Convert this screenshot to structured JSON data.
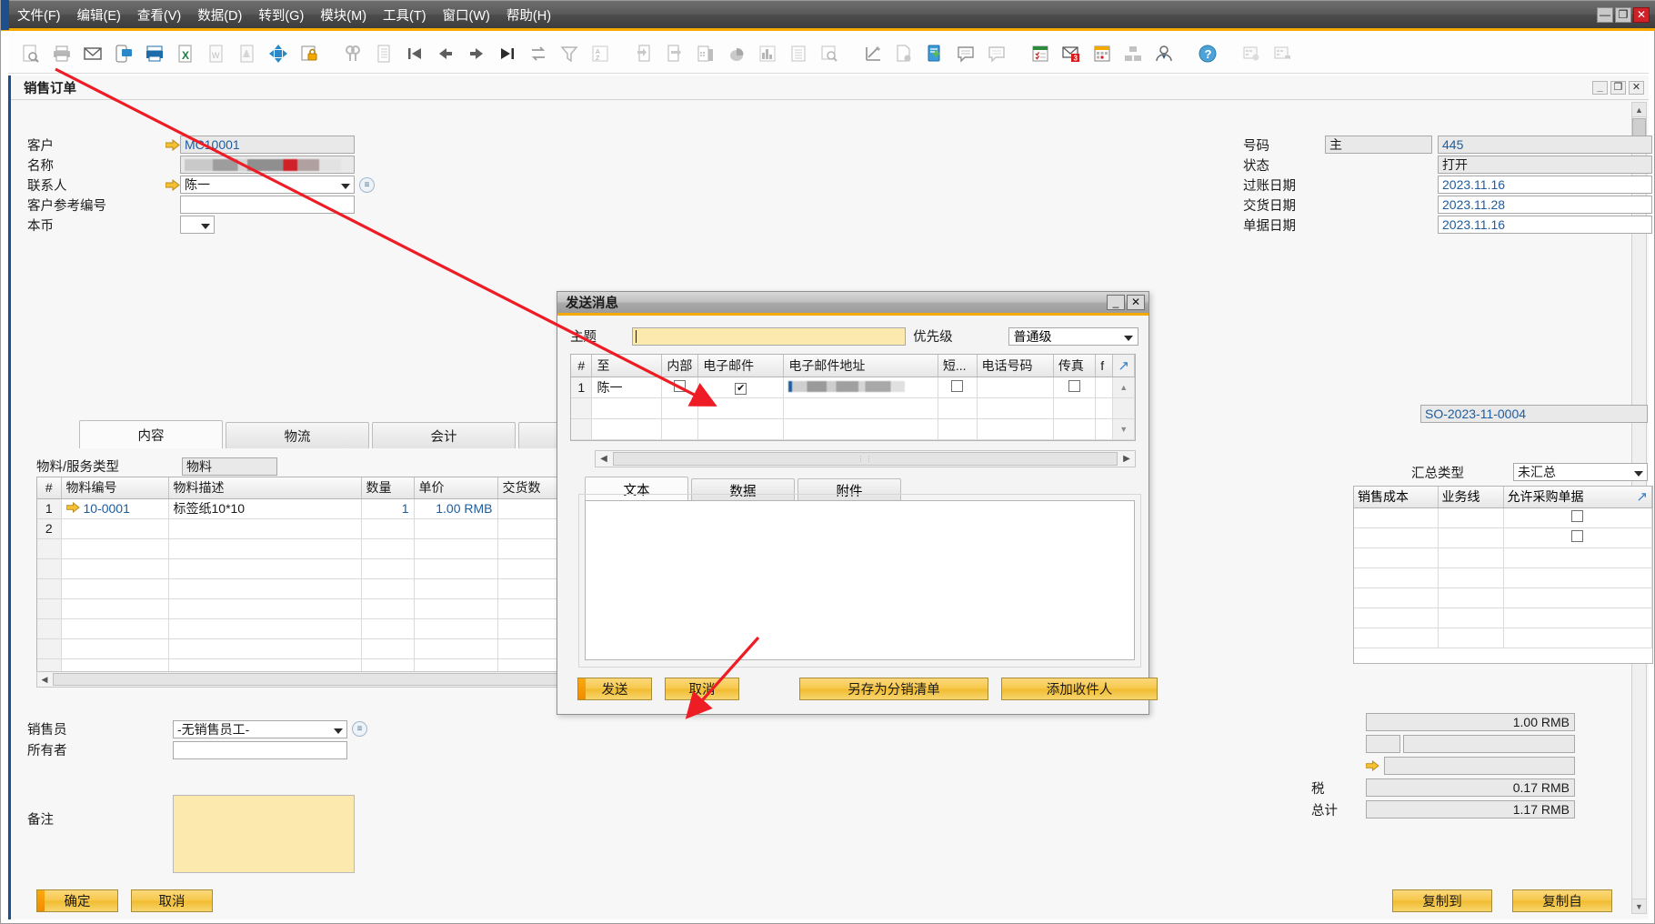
{
  "menubar": {
    "items": [
      {
        "label": "文件(F)",
        "accel": "F"
      },
      {
        "label": "编辑(E)",
        "accel": "E"
      },
      {
        "label": "查看(V)",
        "accel": "V"
      },
      {
        "label": "数据(D)",
        "accel": "D"
      },
      {
        "label": "转到(G)",
        "accel": "G"
      },
      {
        "label": "模块(M)",
        "accel": "M"
      },
      {
        "label": "工具(T)",
        "accel": "T"
      },
      {
        "label": "窗口(W)",
        "accel": "W"
      },
      {
        "label": "帮助(H)",
        "accel": "H"
      }
    ],
    "window_controls": {
      "minimize": "—",
      "restore": "❐",
      "close": "✕"
    }
  },
  "toolbar": {
    "icons": [
      "print-preview-icon",
      "print-icon",
      "email-icon",
      "sms-icon",
      "fax-icon",
      "export-excel-icon",
      "export-word-icon",
      "export-pdf-icon",
      "launch-app-icon",
      "lock-icon",
      "find-icon",
      "list-icon",
      "first-record-icon",
      "previous-record-icon",
      "next-record-icon",
      "last-record-icon",
      "add-row-icon",
      "filter-icon",
      "sort-icon",
      "copy-from-icon",
      "copy-to-icon",
      "calculator-icon",
      "pie-chart-icon",
      "bar-chart-icon",
      "report-icon",
      "query-icon",
      "graph-edit-icon",
      "document-settings-icon",
      "database-addon-icon",
      "message-icon",
      "message-send-icon",
      "calendar-tasks-icon",
      "inbox-alert-icon",
      "schedule-icon",
      "org-chart-icon",
      "user-icon",
      "help-icon",
      "drag-cells-icon",
      "drag-cells-out-icon"
    ]
  },
  "document": {
    "title": "销售订单",
    "controls": {
      "minimize": "_",
      "restore": "❐",
      "close": "✕"
    },
    "header_left": [
      {
        "label": "客户",
        "value": "MC10001",
        "link": true,
        "type": "text",
        "style": "gray-blue"
      },
      {
        "label": "名称",
        "value": "",
        "link": false,
        "type": "redacted",
        "style": "gray"
      },
      {
        "label": "联系人",
        "value": "陈一",
        "link": true,
        "type": "dropdown",
        "has_note": true
      },
      {
        "label": "客户参考编号",
        "value": "",
        "link": false,
        "type": "text",
        "style": "white"
      },
      {
        "label": "本币",
        "value": "",
        "link": false,
        "type": "dropdown-small"
      }
    ],
    "header_right": [
      {
        "label": "号码",
        "sub": "主",
        "value": "445"
      },
      {
        "label": "状态",
        "sub": "",
        "value": "打开"
      },
      {
        "label": "过账日期",
        "sub": "",
        "value": "2023.11.16"
      },
      {
        "label": "交货日期",
        "sub": "",
        "value": "2023.11.28"
      },
      {
        "label": "单据日期",
        "sub": "",
        "value": "2023.11.16"
      }
    ],
    "so_number": "SO-2023-11-0004",
    "tabs": [
      {
        "label": "内容",
        "active": true
      },
      {
        "label": "物流",
        "active": false
      },
      {
        "label": "会计",
        "active": false
      },
      {
        "label": "",
        "active": false
      }
    ],
    "item_type": {
      "label": "物料/服务类型",
      "value": "物料"
    },
    "grid": {
      "columns": [
        "#",
        "物料编号",
        "物料描述",
        "数量",
        "单价",
        "交货数"
      ],
      "rows": [
        {
          "num": "1",
          "code": "10-0001",
          "desc": "标签纸10*10",
          "qty": "1",
          "price": "1.00 RMB",
          "delivered": ""
        },
        {
          "num": "2",
          "code": "",
          "desc": "",
          "qty": "",
          "price": "",
          "delivered": ""
        }
      ],
      "empty_rows": 6
    },
    "summary": {
      "type_label": "汇总类型",
      "type_value": "未汇总",
      "columns": [
        "销售成本",
        "业务线",
        "允许采购单据"
      ]
    },
    "bottom_left": [
      {
        "label": "销售员",
        "value": "-无销售员工-",
        "type": "dropdown",
        "has_note": true
      },
      {
        "label": "所有者",
        "value": "",
        "type": "text"
      }
    ],
    "remark_label": "备注",
    "totals": [
      {
        "label": "",
        "value": "1.00 RMB",
        "pct": ""
      },
      {
        "label": "",
        "value": "",
        "pct": "%"
      },
      {
        "label": "",
        "value": "",
        "pct": ""
      },
      {
        "label": "税",
        "value": "0.17 RMB",
        "pct": ""
      },
      {
        "label": "总计",
        "value": "1.17 RMB",
        "pct": ""
      }
    ],
    "footer_buttons_left": [
      {
        "label": "确定",
        "default": true
      },
      {
        "label": "取消",
        "default": false
      }
    ],
    "footer_buttons_right": [
      {
        "label": "复制到",
        "default": false
      },
      {
        "label": "复制自",
        "default": false
      }
    ]
  },
  "dialog": {
    "title": "发送消息",
    "controls": {
      "minimize": "_",
      "close": "✕"
    },
    "subject": {
      "label": "主题",
      "value": "",
      "placeholder": ""
    },
    "priority": {
      "label": "优先级",
      "value": "普通级"
    },
    "recipients": {
      "columns": [
        "#",
        "至",
        "内部",
        "电子邮件",
        "电子邮件地址",
        "短...",
        "电话号码",
        "传真",
        "f"
      ],
      "rows": [
        {
          "num": "1",
          "to": "陈一",
          "internal": false,
          "email": true,
          "address": "",
          "sms": false,
          "phone": "",
          "fax": false
        }
      ],
      "empty_rows": 2
    },
    "tabs": [
      {
        "label": "文本",
        "active": true
      },
      {
        "label": "数据",
        "active": false
      },
      {
        "label": "附件",
        "active": false
      }
    ],
    "body_text": "",
    "buttons": [
      {
        "label": "发送",
        "name": "send-button",
        "default": true
      },
      {
        "label": "取消",
        "name": "cancel-button",
        "default": false
      },
      {
        "label": "另存为分销清单",
        "name": "save-distribution-list-button",
        "default": false
      },
      {
        "label": "添加收件人",
        "name": "add-recipient-button",
        "default": false
      }
    ]
  },
  "colors": {
    "accent": "#f5a800",
    "titlebar": "#4c4c4c",
    "window_border_left": "#1d4f8c",
    "required_field": "#fbe9ae",
    "button": "#f6c74a",
    "link_text": "#1d5c9e",
    "annotation": "#ee1c25"
  }
}
